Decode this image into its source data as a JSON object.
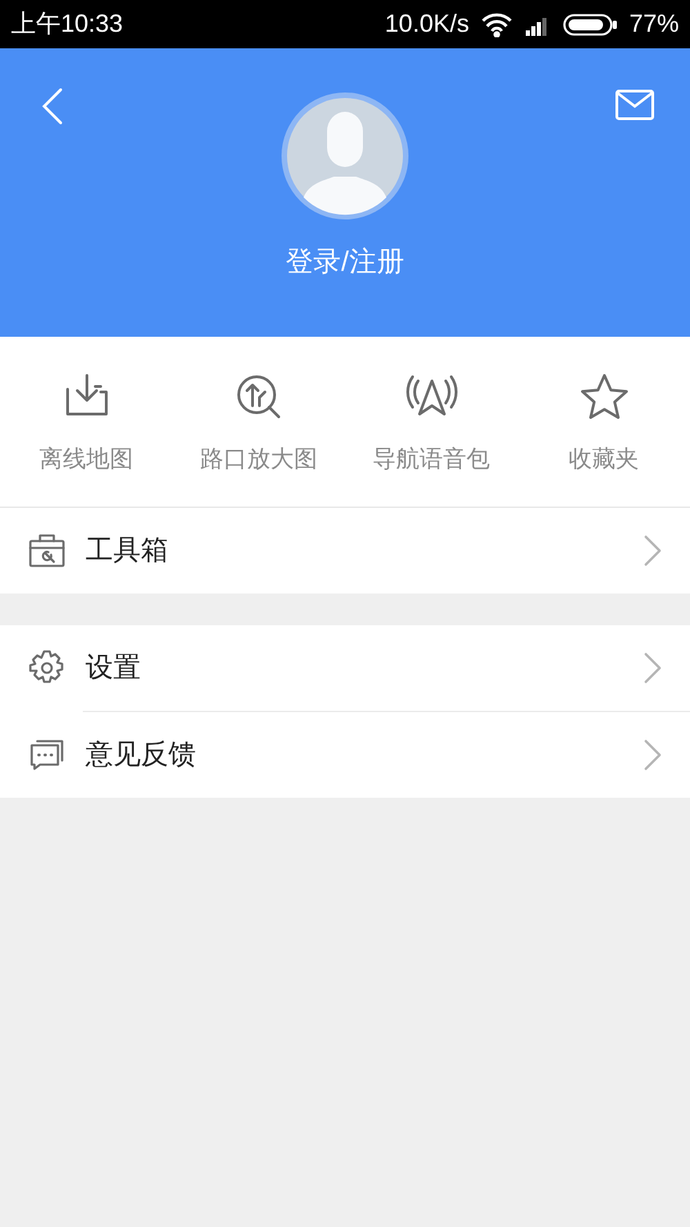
{
  "status_bar": {
    "time": "上午10:33",
    "network_speed": "10.0K/s",
    "battery": "77%"
  },
  "header": {
    "login_label": "登录/注册"
  },
  "quick_actions": [
    {
      "kind": "download",
      "label": "离线地图"
    },
    {
      "kind": "zoom",
      "label": "路口放大图"
    },
    {
      "kind": "voice",
      "label": "导航语音包"
    },
    {
      "kind": "star",
      "label": "收藏夹"
    }
  ],
  "menu_groups": [
    [
      {
        "kind": "toolbox",
        "label": "工具箱"
      }
    ],
    [
      {
        "kind": "settings",
        "label": "设置"
      },
      {
        "kind": "feedback",
        "label": "意见反馈"
      }
    ]
  ]
}
